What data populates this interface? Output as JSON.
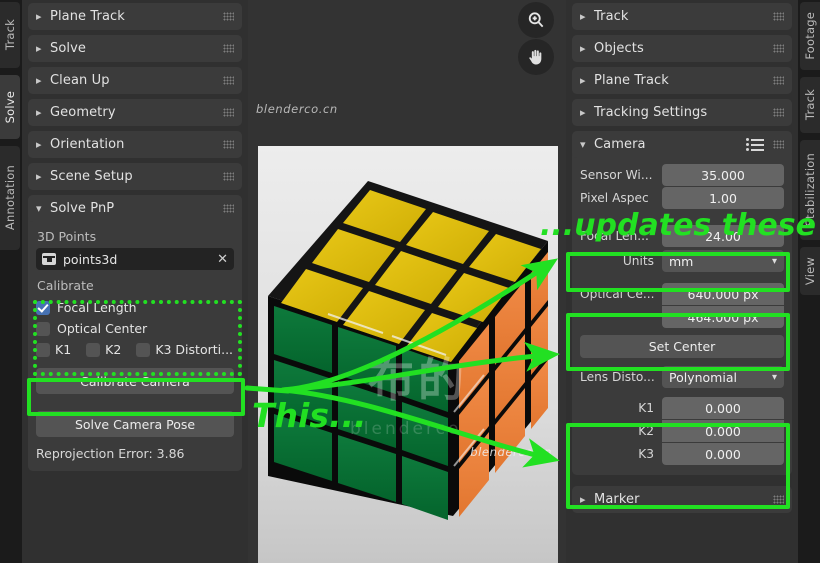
{
  "app": {
    "name": "Blender Movie Clip Editor"
  },
  "left_tabs": [
    {
      "label": "Track",
      "active": false
    },
    {
      "label": "Solve",
      "active": true
    },
    {
      "label": "Annotation",
      "active": false
    }
  ],
  "right_tabs": [
    {
      "label": "Footage",
      "active": false
    },
    {
      "label": "Track",
      "active": false
    },
    {
      "label": "Stabilization",
      "active": false
    },
    {
      "label": "View",
      "active": false
    }
  ],
  "left_panel": {
    "collapsed_sections": [
      {
        "label": "Plane Track"
      },
      {
        "label": "Solve"
      },
      {
        "label": "Clean Up"
      },
      {
        "label": "Geometry"
      },
      {
        "label": "Orientation"
      },
      {
        "label": "Scene Setup"
      }
    ],
    "solve_pnp": {
      "title": "Solve PnP",
      "points_label": "3D Points",
      "points_value": "points3d",
      "clear_icon": "✕",
      "calibrate_label": "Calibrate",
      "checkboxes": [
        {
          "label": "Focal Length",
          "checked": true
        },
        {
          "label": "Optical Center",
          "checked": false
        }
      ],
      "distortion_checks": [
        {
          "label": "K1",
          "checked": false
        },
        {
          "label": "K2",
          "checked": false
        },
        {
          "label": "K3 Distorti...",
          "checked": false
        }
      ],
      "calibrate_button": "Calibrate Camera",
      "solve_button": "Solve Camera Pose",
      "reprojection_error": "Reprojection Error: 3.86"
    }
  },
  "right_panel": {
    "collapsed_sections": [
      {
        "label": "Track"
      },
      {
        "label": "Objects"
      },
      {
        "label": "Plane Track"
      },
      {
        "label": "Tracking Settings"
      }
    ],
    "camera": {
      "title": "Camera",
      "rows": [
        {
          "label": "Sensor Wi...",
          "value": "35.000"
        },
        {
          "label": "Pixel Aspec",
          "value": "1.00"
        },
        {
          "label": "Focal Len...",
          "value": "24.00"
        }
      ],
      "units_label": "Units",
      "units_value": "mm",
      "optical_center_label": "Optical Ce...",
      "optical_center_x": "640.000 px",
      "optical_center_y": "464.000 px",
      "set_center_button": "Set Center",
      "lens_distortion_label": "Lens Disto...",
      "lens_distortion_value": "Polynomial",
      "distortion_coeffs": [
        {
          "label": "K1",
          "value": "0.000"
        },
        {
          "label": "K2",
          "value": "0.000"
        },
        {
          "label": "K3",
          "value": "0.000"
        }
      ]
    },
    "marker_section": {
      "label": "Marker"
    }
  },
  "viewport": {
    "zoom_tool": "zoom-in-tool",
    "pan_tool": "pan-hand-tool",
    "watermark_top": "blenderco.cn",
    "watermark_bottom": "blenderco.cn",
    "image_watermark": "布的"
  },
  "annotations": {
    "this_label": "This...",
    "updates_label": "...updates these",
    "accent_color": "#22e022"
  }
}
